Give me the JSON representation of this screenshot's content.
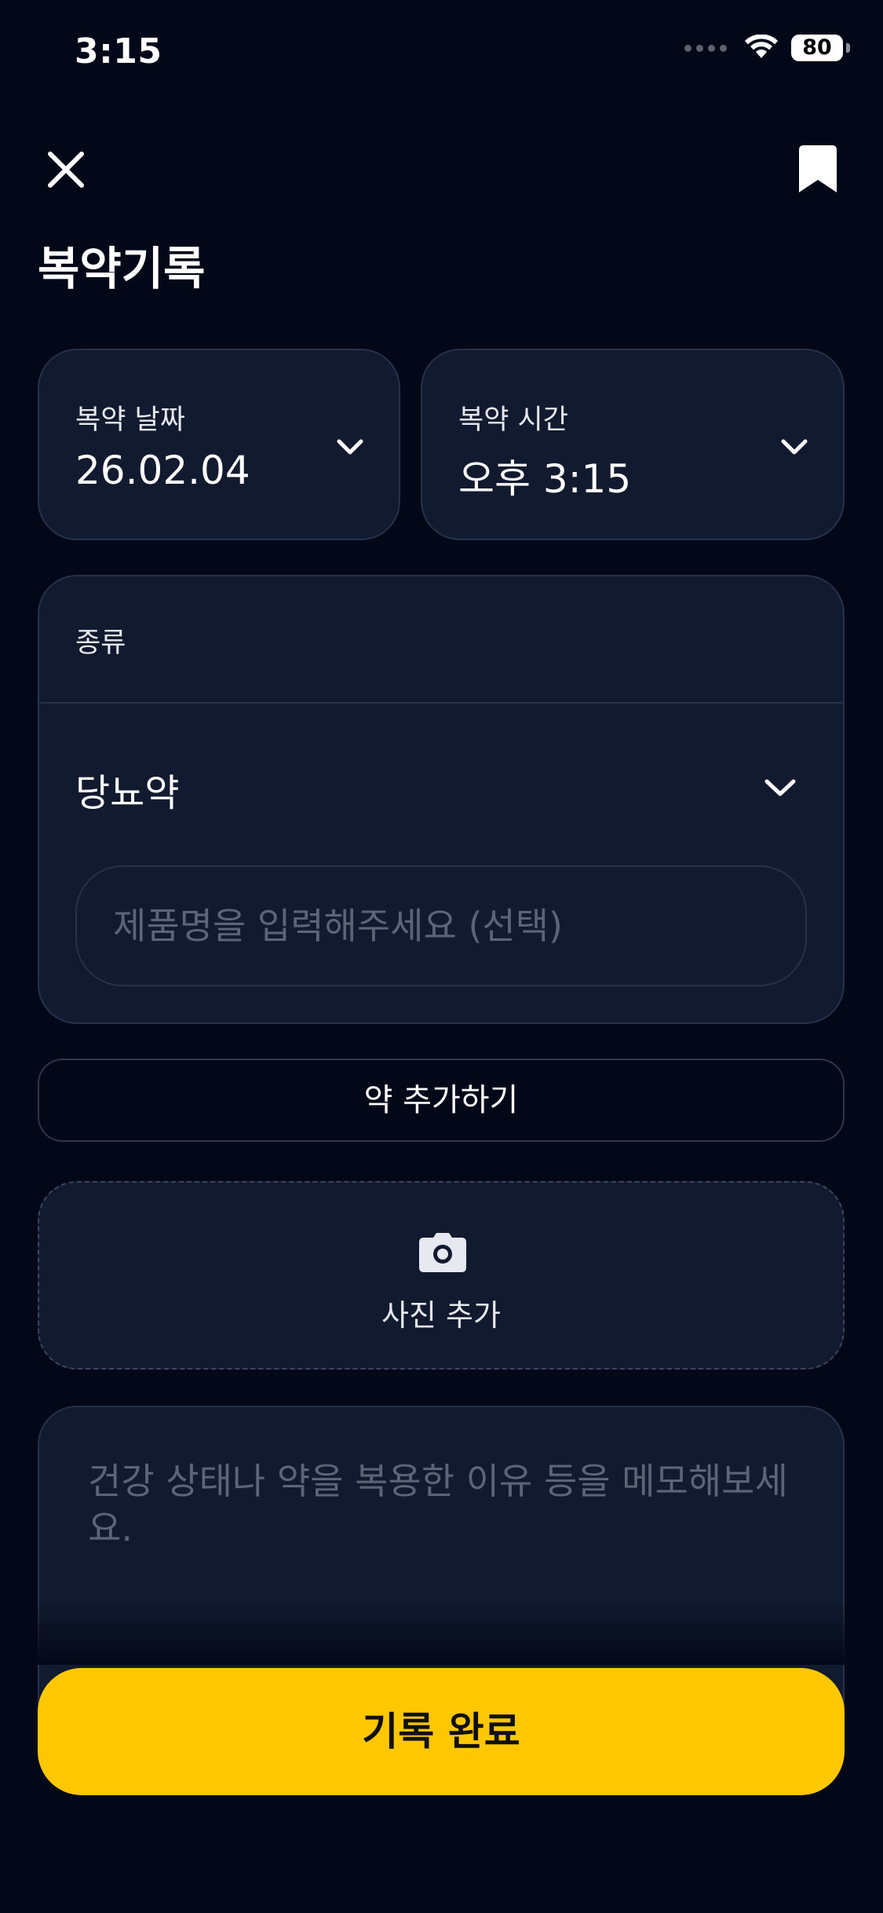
{
  "status_bar": {
    "time": "3:15",
    "battery": "80"
  },
  "header": {
    "title": "복약기록"
  },
  "date_field": {
    "label": "복약 날짜",
    "value": "26.02.04"
  },
  "time_field": {
    "label": "복약 시간",
    "value": "오후 3:15"
  },
  "type_section": {
    "label": "종류",
    "selected": "당뇨약",
    "product_placeholder": "제품명을 입력해주세요 (선택)"
  },
  "add_medication_label": "약 추가하기",
  "photo": {
    "label": "사진 추가"
  },
  "memo": {
    "placeholder": "건강 상태나 약을 복용한 이유 등을 메모해보세요."
  },
  "submit_label": "기록 완료",
  "icons": {
    "close": "close-icon",
    "bookmark": "bookmark-icon",
    "chevron": "chevron-down-icon",
    "camera": "camera-icon"
  },
  "colors": {
    "background": "#020817",
    "card": "#111a2e",
    "border": "#26324a",
    "accent": "#ffc700",
    "placeholder": "#5b6577"
  }
}
